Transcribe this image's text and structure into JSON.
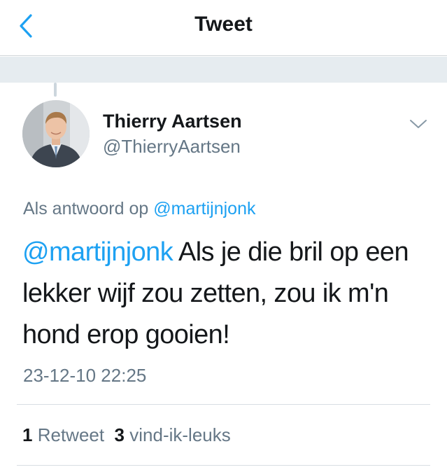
{
  "header": {
    "back_icon": "chevron-left-icon",
    "title": "Tweet"
  },
  "tweet": {
    "author_name": "Thierry Aartsen",
    "author_handle": "@ThierryAartsen",
    "reply_prefix": "Als antwoord op",
    "reply_to": "@martijnjonk",
    "text_mention": "@martijnjonk",
    "text_body": " Als je die bril op een lekker wijf zou zetten, zou ik m'n hond erop gooien!",
    "timestamp": "23-12-10 22:25",
    "retweet_count": "1",
    "retweet_label": "Retweet",
    "like_count": "3",
    "like_label": "vind-ik-leuks"
  },
  "colors": {
    "accent": "#1da1f2",
    "secondary_text": "#657786",
    "primary_text": "#14171a",
    "band": "#e6ecf0"
  }
}
